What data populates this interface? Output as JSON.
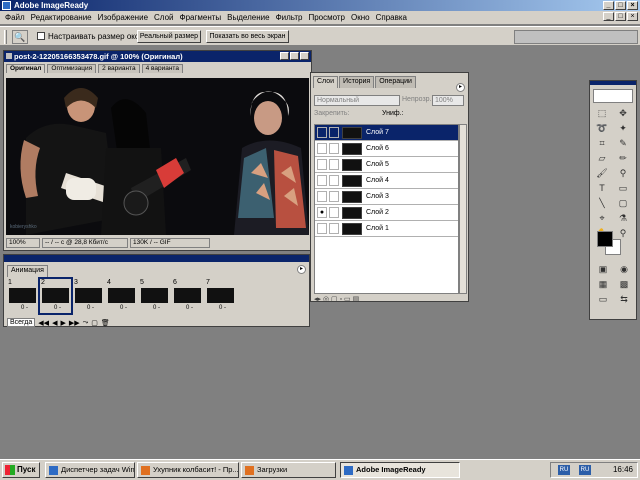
{
  "window": {
    "title": "Adobe ImageReady"
  },
  "menu": [
    "Файл",
    "Редактирование",
    "Изображение",
    "Слой",
    "Фрагменты",
    "Выделение",
    "Фильтр",
    "Просмотр",
    "Окно",
    "Справка"
  ],
  "options": {
    "resize_windows": "Настраивать размер окон",
    "actual_size": "Реальный размер",
    "fit_screen": "Показать во весь экран"
  },
  "document": {
    "title": "post-2-12205166353478.gif @ 100% (Оригинал)",
    "tabs": [
      "Оригинал",
      "Оптимизация",
      "2 варианта",
      "4 варианта"
    ],
    "status": {
      "zoom": "100%",
      "download": "-- / -- с @ 28,8 Кбит/с",
      "size": "130K / -- GIF"
    },
    "watermark": "kobieryshko"
  },
  "layers_panel": {
    "tabs": [
      "Слои",
      "История",
      "Операции"
    ],
    "blend_mode": "Нормальный",
    "opacity_label": "Непрозр.:",
    "opacity_value": "100%",
    "lock_label": "Закрепить:",
    "unify_label": "Униф.:",
    "layers": [
      "Слой 7",
      "Слой 6",
      "Слой 5",
      "Слой 4",
      "Слой 3",
      "Слой 2",
      "Слой 1"
    ]
  },
  "animation": {
    "title": "Анимация",
    "frames": [
      {
        "num": "1",
        "delay": "0 -"
      },
      {
        "num": "2",
        "delay": "0 -"
      },
      {
        "num": "3",
        "delay": "0 -"
      },
      {
        "num": "4",
        "delay": "0 -"
      },
      {
        "num": "5",
        "delay": "0 -"
      },
      {
        "num": "6",
        "delay": "0 -"
      },
      {
        "num": "7",
        "delay": "0 -"
      }
    ],
    "loop": "Всегда"
  },
  "taskbar": {
    "start": "Пуск",
    "tasks": [
      "Диспетчер задач Wind...",
      "Ухупник колбасит! - Пр...",
      "Загрузки",
      "Adobe ImageReady"
    ],
    "lang": "RU",
    "time": "16:46"
  },
  "colors": {
    "title_active": "#0a246a",
    "face": "#d4d0c8",
    "desktop": "#808080"
  }
}
